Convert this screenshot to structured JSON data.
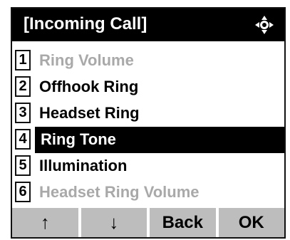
{
  "header": {
    "title": "[Incoming Call]",
    "nav_icon": "four-way-navigation-icon"
  },
  "menu": {
    "items": [
      {
        "number": "1",
        "label": "Ring Volume",
        "state": "disabled"
      },
      {
        "number": "2",
        "label": "Offhook Ring",
        "state": "normal"
      },
      {
        "number": "3",
        "label": "Headset Ring",
        "state": "normal"
      },
      {
        "number": "4",
        "label": "Ring Tone",
        "state": "selected"
      },
      {
        "number": "5",
        "label": "Illumination",
        "state": "normal"
      },
      {
        "number": "6",
        "label": "Headset Ring Volume",
        "state": "disabled"
      }
    ]
  },
  "softkeys": {
    "up": "↑",
    "down": "↓",
    "back": "Back",
    "ok": "OK"
  },
  "colors": {
    "title_bg": "#000000",
    "title_text": "#ffffff",
    "selected_bg": "#000000",
    "disabled_text": "#a9a9a9",
    "softkey_bg": "#bdbdbd"
  }
}
